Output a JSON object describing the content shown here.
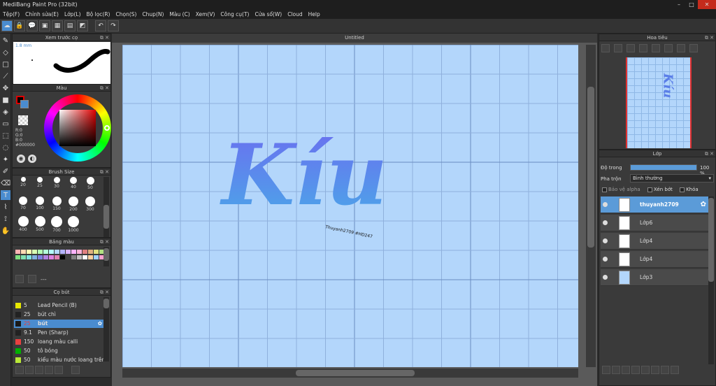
{
  "window": {
    "title": "MediBang Paint Pro (32bit)",
    "controls": [
      "–",
      "□",
      "✕"
    ]
  },
  "menu": [
    "Tệp(F)",
    "Chỉnh sửa(E)",
    "Lớp(L)",
    "Bộ lọc(R)",
    "Chọn(S)",
    "Chup(N)",
    "Màu (C)",
    "Xem(V)",
    "Công cụ(T)",
    "Cửa sổ(W)",
    "Cloud",
    "Help"
  ],
  "panels": {
    "brush_preview": {
      "title": "Xem trước cọ",
      "size_label": "1.8 mm"
    },
    "color": {
      "title": "Màu",
      "rgb": [
        "R:0",
        "G:0",
        "B:0"
      ],
      "hex": "#000000"
    },
    "brush_size": {
      "title": "Brush Size",
      "sizes": [
        "20",
        "25",
        "30",
        "40",
        "50",
        "70",
        "100",
        "150",
        "200",
        "300",
        "400",
        "500",
        "700",
        "1000"
      ]
    },
    "palette": {
      "title": "Bảng màu",
      "dash": "---"
    },
    "brush_list": {
      "title": "Cọ bút",
      "items": [
        {
          "size": "5",
          "name": "Lead Pencil (B)",
          "color": "#e8e800"
        },
        {
          "size": "25",
          "name": "bút chì",
          "color": "#222222"
        },
        {
          "size": "25",
          "name": "bút",
          "color": "#1a1a1a",
          "selected": true
        },
        {
          "size": "9.1",
          "name": "Pen (Sharp)",
          "color": "#222222"
        },
        {
          "size": "150",
          "name": "loang màu calli",
          "color": "#e84040"
        },
        {
          "size": "50",
          "name": "tô bóng",
          "color": "#00b000"
        },
        {
          "size": "50",
          "name": "kiểu màu nước loang trên",
          "color": "#b8e838"
        }
      ]
    },
    "canvas": {
      "tab": "Untitled",
      "artwork_text": "Kíu",
      "signature": "Thuyanh2709 #HD247"
    },
    "navigator": {
      "title": "Hoa tiêu"
    },
    "layers": {
      "title": "Lớp",
      "opacity_label": "Độ trong",
      "opacity_value": "100 %",
      "opacity_fraction": 1.0,
      "blend_label": "Pha trộn",
      "blend_value": "Bình thường",
      "protect_alpha": "Bảo vệ alpha",
      "clipping": "Xén bớt",
      "lock": "Khóa",
      "items": [
        {
          "name": "thuyanh2709",
          "selected": true
        },
        {
          "name": "Lớp6"
        },
        {
          "name": "Lớp4"
        },
        {
          "name": "Lớp4"
        },
        {
          "name": "Lớp3"
        }
      ]
    }
  },
  "colors": {
    "accent": "#4a8ccf",
    "canvas": "#b3d6fb",
    "art_top": "#6b6ef0",
    "art_bottom": "#4aa8e8"
  }
}
